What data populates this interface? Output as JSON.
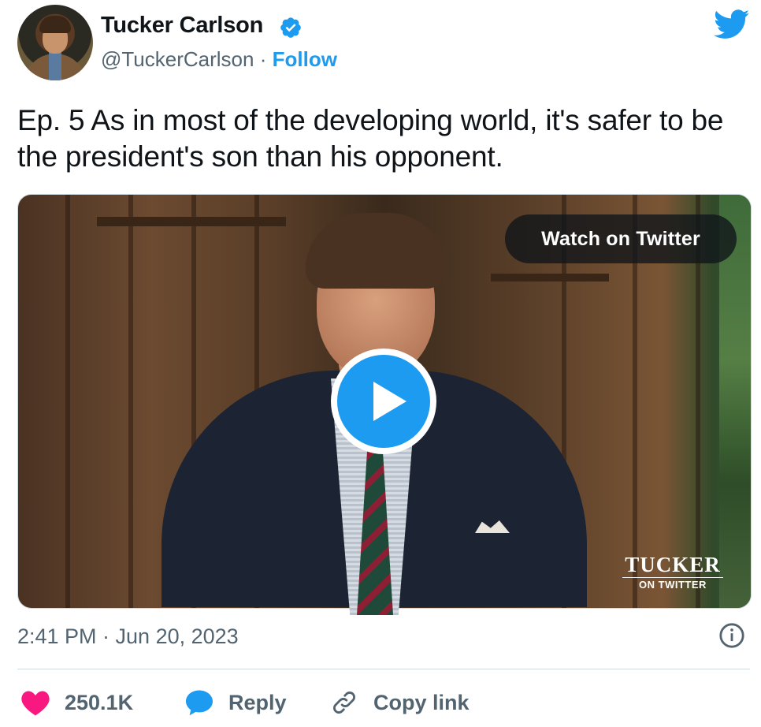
{
  "tweet": {
    "author_name": "Tucker Carlson",
    "handle": "@TuckerCarlson",
    "separator": "·",
    "follow_label": "Follow",
    "text": "Ep. 5  As in most of the developing world, it's safer to be the president's son than his opponent.",
    "timestamp": "2:41 PM · Jun 20, 2023"
  },
  "media": {
    "watch_label": "Watch on Twitter",
    "brand_title": "TUCKER",
    "brand_subtitle": "ON TWITTER"
  },
  "actions": {
    "like_count": "250.1K",
    "reply_label": "Reply",
    "copy_link_label": "Copy link"
  },
  "colors": {
    "accent": "#1d9bf0",
    "like": "#f91880",
    "secondary_text": "#536471"
  },
  "icons": [
    "verified-badge-icon",
    "twitter-bird-icon",
    "play-icon",
    "info-icon",
    "heart-icon",
    "reply-bubble-icon",
    "link-icon"
  ]
}
